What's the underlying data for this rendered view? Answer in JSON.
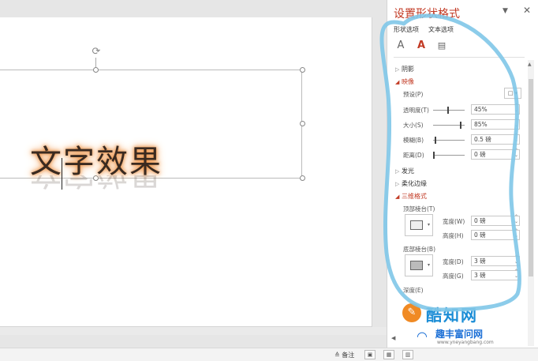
{
  "slide": {
    "wordart_text": "文字效果"
  },
  "panel": {
    "title": "设置形状格式",
    "tabs": {
      "shape": "形状选项",
      "text": "文本选项"
    },
    "sections": {
      "shadow": "阴影",
      "reflection": "映像",
      "glow": "发光",
      "soft_edges": "柔化边缘",
      "format_3d": "三维格式"
    },
    "reflection": {
      "preset_label": "预设(P)",
      "transparency_label": "透明度(T)",
      "transparency_value": "45%",
      "size_label": "大小(S)",
      "size_value": "85%",
      "blur_label": "模糊(B)",
      "blur_value": "0.5 磅",
      "distance_label": "距离(D)",
      "distance_value": "0 磅"
    },
    "format_3d": {
      "top_bevel_label": "顶部棱台(T)",
      "top_width_label": "宽度(W)",
      "top_width_value": "0 磅",
      "top_height_label": "高度(H)",
      "top_height_value": "0 磅",
      "bottom_bevel_label": "底部棱台(B)",
      "bottom_width_label": "宽度(D)",
      "bottom_width_value": "3 磅",
      "bottom_height_label": "高度(G)",
      "bottom_height_value": "3 磅",
      "depth_label": "深度(E)"
    }
  },
  "statusbar": {
    "notes_label": "备注"
  },
  "watermarks": {
    "primary": "酷知网",
    "secondary": "趣丰富问网",
    "secondary_url": "www.yneyangbang.com"
  }
}
